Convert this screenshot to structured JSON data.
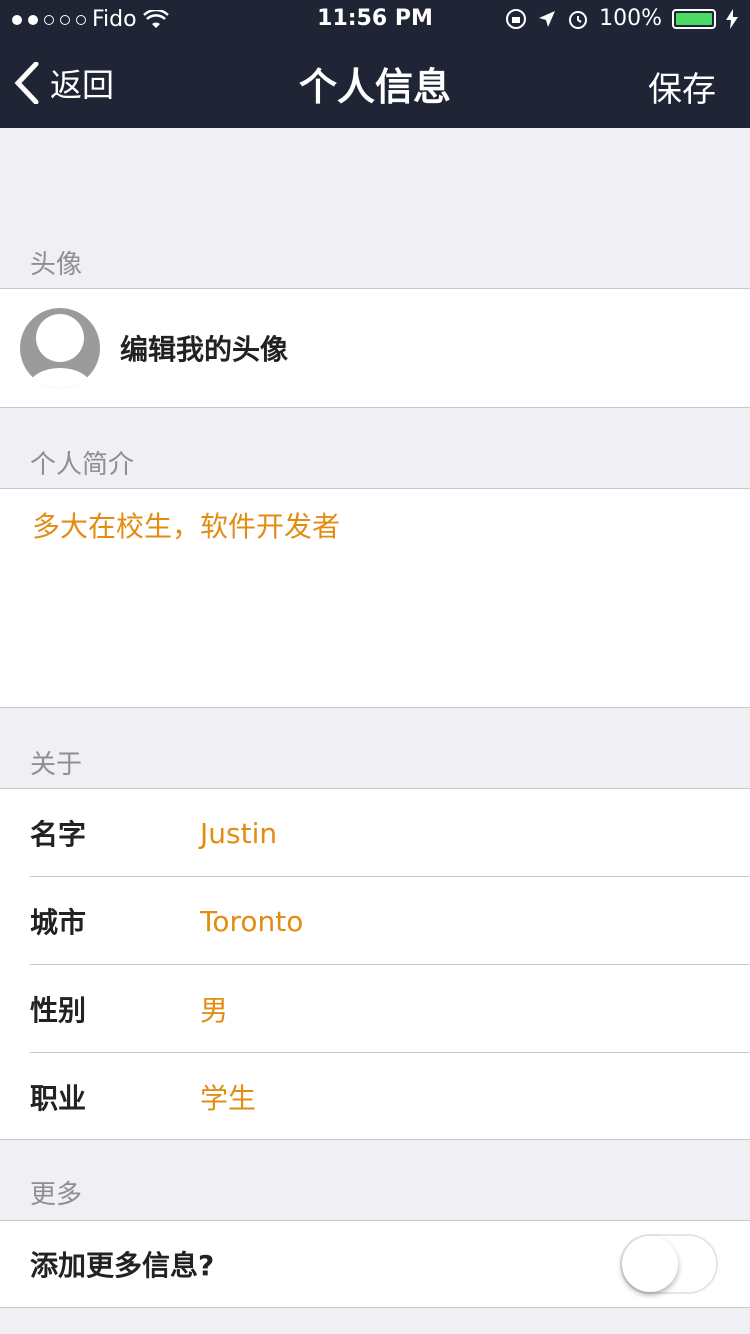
{
  "status": {
    "carrier": "Fido",
    "time": "11:56 PM",
    "battery": "100%"
  },
  "nav": {
    "back_label": "返回",
    "title": "个人信息",
    "save_label": "保存"
  },
  "sections": {
    "avatar": "头像",
    "bio": "个人简介",
    "about": "关于",
    "more": "更多"
  },
  "avatar": {
    "label": "编辑我的头像"
  },
  "bio": {
    "text": "多大在校生，软件开发者"
  },
  "about": [
    {
      "key": "名字",
      "value": "Justin"
    },
    {
      "key": "城市",
      "value": "Toronto"
    },
    {
      "key": "性别",
      "value": "男"
    },
    {
      "key": "职业",
      "value": "学生"
    }
  ],
  "more": {
    "label": "添加更多信息?",
    "toggle_on": false
  },
  "colors": {
    "nav_bg": "#202535",
    "accent": "#e28d12",
    "battery": "#4cd964"
  }
}
